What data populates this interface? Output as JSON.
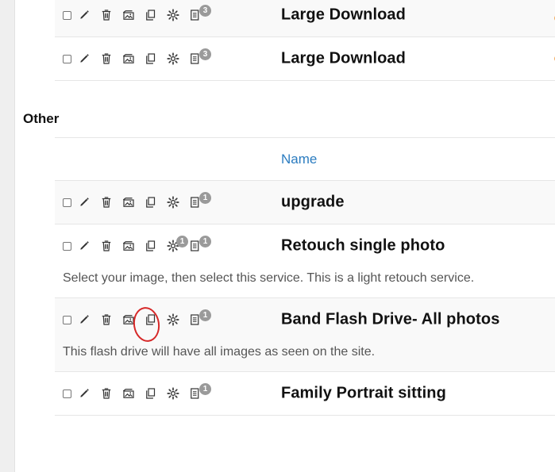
{
  "colors": {
    "page_bg": "#efefef",
    "panel_bg": "#ffffff",
    "header_link": "#2b7cc0",
    "badge_bg": "#9a9a9a",
    "annotation": "#d62828",
    "text_main": "#111111",
    "text_muted": "#555555"
  },
  "icons": {
    "checkbox": "checkbox-icon",
    "edit": "pencil-icon",
    "delete": "trash-icon",
    "image": "image-icon",
    "duplicate": "copy-icon",
    "settings": "gear-icon",
    "document": "document-icon"
  },
  "top_rows": [
    {
      "title": "Large Download",
      "document_badge": "3"
    },
    {
      "title": "Large Download",
      "document_badge": "3"
    }
  ],
  "section": {
    "title": "Other",
    "columns": {
      "name": "Name"
    }
  },
  "other_rows": [
    {
      "title": "upgrade",
      "document_badge": "1",
      "settings_badge": "",
      "description": ""
    },
    {
      "title": "Retouch single photo",
      "document_badge": "1",
      "settings_badge": "1",
      "description": "Select your image, then select this service. This is a light retouch service."
    },
    {
      "title": "Band Flash Drive- All photos",
      "document_badge": "1",
      "settings_badge": "",
      "description": "This flash drive will have all images as seen on the site."
    },
    {
      "title": "Family Portrait sitting",
      "document_badge": "1",
      "settings_badge": "",
      "description": ""
    }
  ]
}
